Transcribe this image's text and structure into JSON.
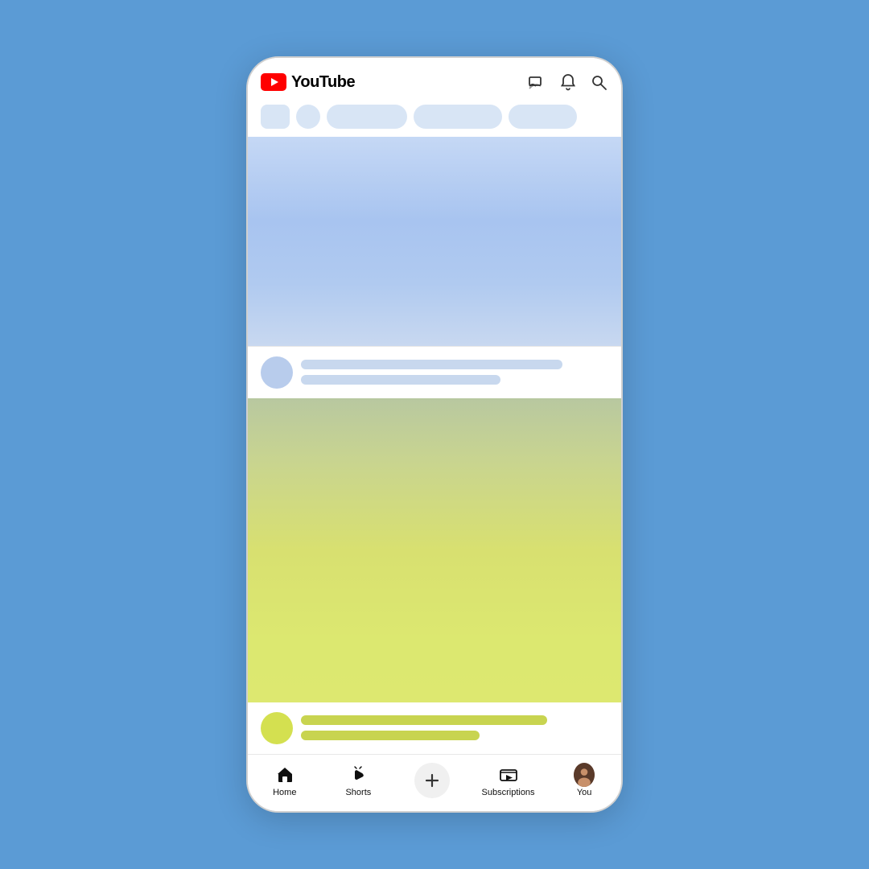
{
  "app": {
    "title": "YouTube",
    "logo_text": "YouTube"
  },
  "filter_chips": [
    "square",
    "circle",
    "pill1",
    "pill2",
    "pill3"
  ],
  "nav": {
    "items": [
      {
        "id": "home",
        "label": "Home",
        "icon": "home-icon"
      },
      {
        "id": "shorts",
        "label": "Shorts",
        "icon": "shorts-icon"
      },
      {
        "id": "add",
        "label": "+",
        "icon": "add-icon"
      },
      {
        "id": "subscriptions",
        "label": "Subscriptions",
        "icon": "subscriptions-icon"
      },
      {
        "id": "you",
        "label": "You",
        "icon": "user-icon"
      }
    ]
  },
  "colors": {
    "background": "#5b9bd5",
    "phone_bg": "#ffffff",
    "youtube_red": "#ff0000",
    "chip_bg": "#d8e5f5",
    "blue_gradient_top": "#c5d8f5",
    "blue_gradient_bottom": "#c8d8f0",
    "yellow_gradient_top": "#b8c8a0",
    "yellow_gradient_bottom": "#dde870"
  }
}
